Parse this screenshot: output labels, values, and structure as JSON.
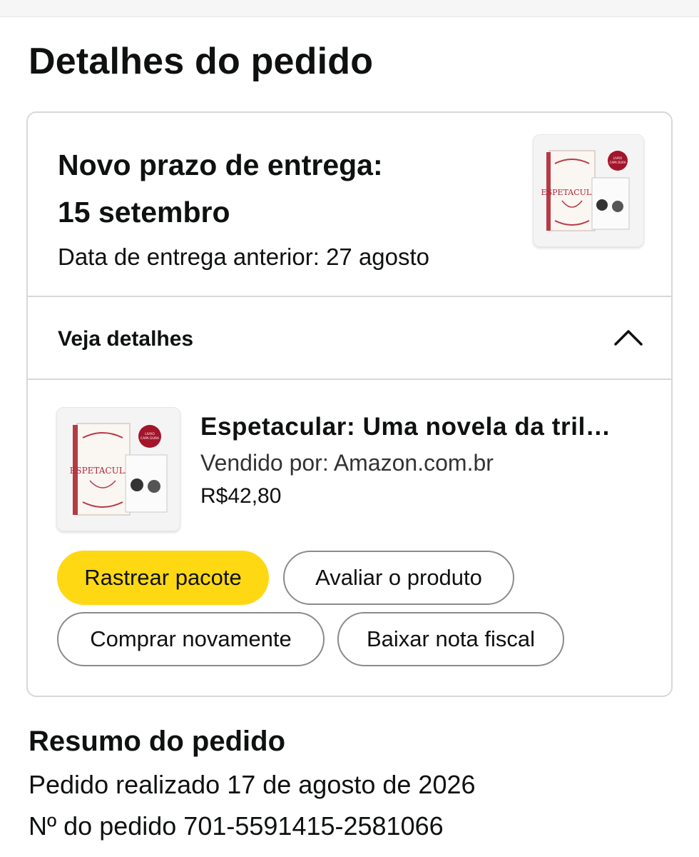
{
  "page": {
    "title": "Detalhes do pedido"
  },
  "delivery": {
    "title_line1": "Novo prazo de entrega:",
    "title_line2": "15 setembro",
    "previous": "Data de entrega anterior: 27 agosto"
  },
  "details": {
    "label": "Veja detalhes",
    "icon": "chevron-up-icon"
  },
  "item": {
    "title": "Espetacular: Uma novela da tril…",
    "seller": "Vendido por: Amazon.com.br",
    "price": "R$42,80",
    "cover_text": "ESPETACULAR",
    "badge_text": "LIVRO CAPA DURA + CARD ESPECIAL"
  },
  "actions": {
    "track": "Rastrear pacote",
    "review": "Avaliar o produto",
    "buy_again": "Comprar novamente",
    "invoice": "Baixar nota fiscal"
  },
  "summary": {
    "title": "Resumo do pedido",
    "date": "Pedido realizado 17 de agosto de 2026",
    "number": "Nº do pedido 701-5591415-2581066"
  },
  "colors": {
    "primary_button": "#ffd814",
    "border": "#d5d9d9",
    "badge": "#a3152a"
  }
}
